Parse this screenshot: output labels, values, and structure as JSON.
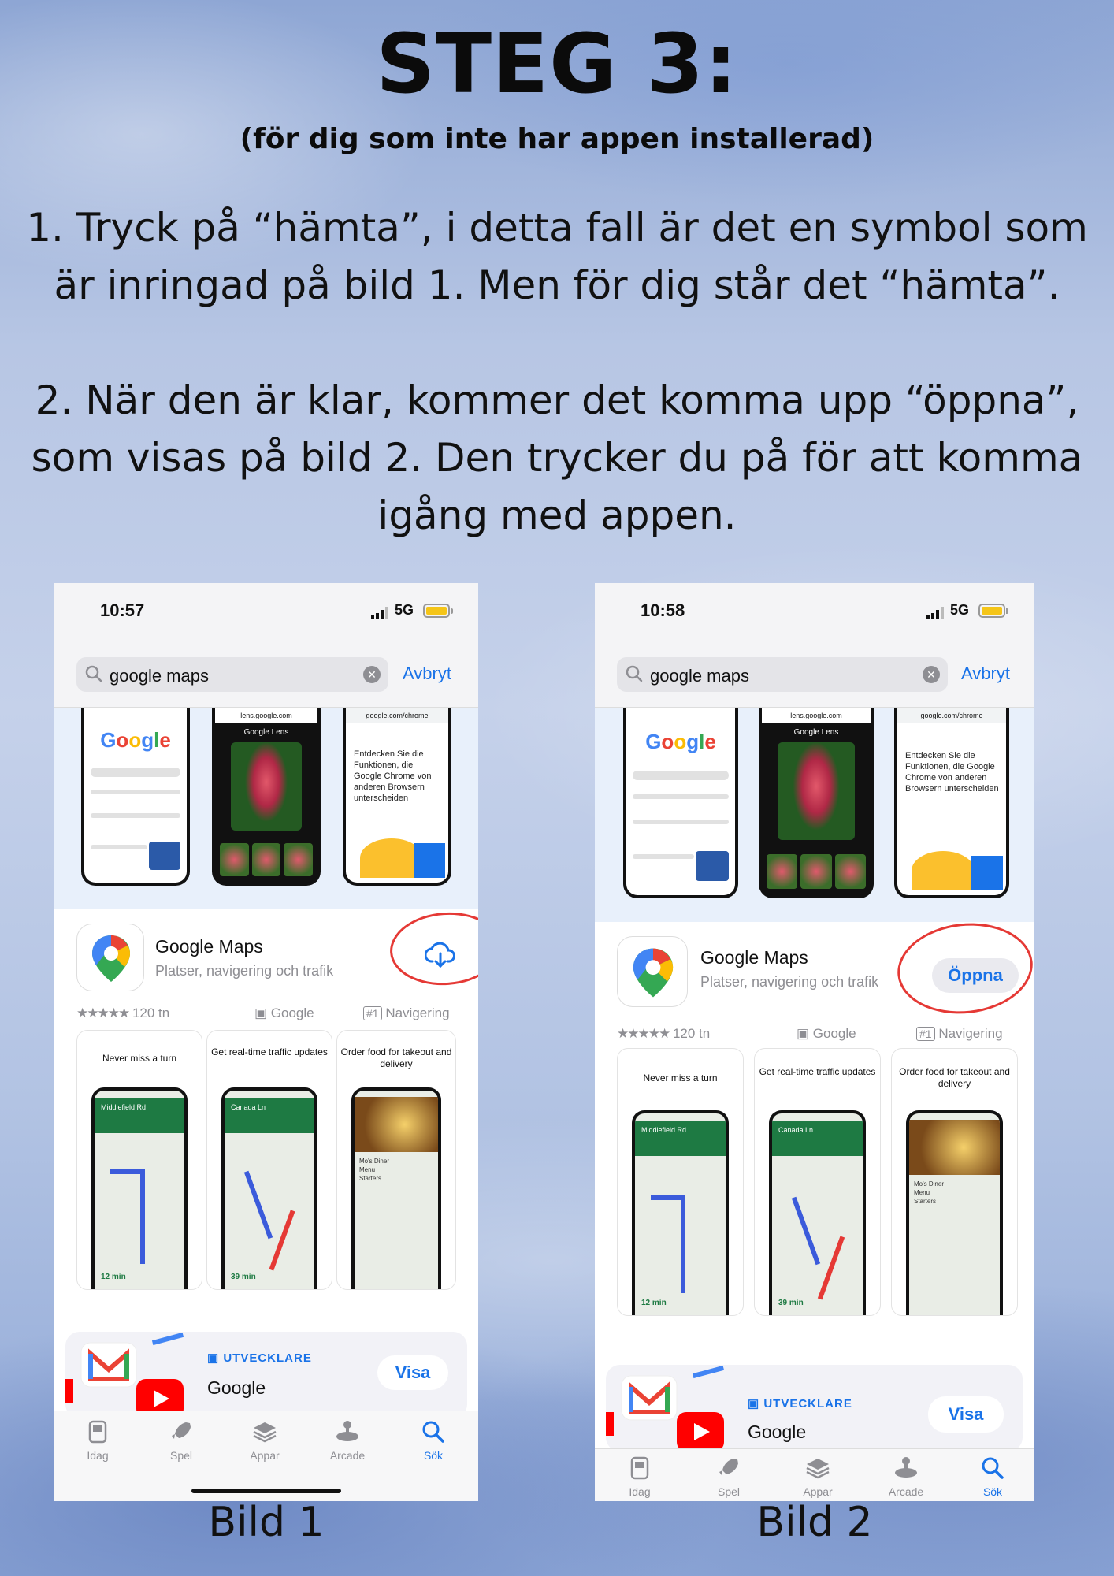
{
  "header": {
    "title": "STEG 3:",
    "subtitle": "(för dig som inte har appen installerad)"
  },
  "instructions": {
    "step1": "1. Tryck på “hämta”, i detta fall är det en symbol som är inringad på bild 1. Men för dig står det “hämta”.",
    "step2": "2. När den är klar, kommer det komma upp “öppna”, som visas på bild 2. Den trycker du på för att komma igång med appen."
  },
  "captions": [
    "Bild 1",
    "Bild 2"
  ],
  "colors": {
    "accent": "#1a73e8",
    "circle": "#e53935",
    "battery": "#f5c518"
  },
  "phones": [
    {
      "time": "10:57",
      "network": "5G",
      "search_query": "google maps",
      "cancel_label": "Avbryt",
      "screenshot_texts": {
        "lens": "Google Lens",
        "chrome_heading": "Entdecken Sie die Funktionen, die Google Chrome von anderen Browsern unterscheiden"
      },
      "app": {
        "name": "Google Maps",
        "subtitle": "Platser, navigering och trafik",
        "rating_count": "120 tn",
        "developer": "Google",
        "rank": "#1",
        "category": "Navigering",
        "action_icon": "download-cloud-icon"
      },
      "promos": [
        "Never miss a turn",
        "Get real-time traffic updates",
        "Order food for takeout and delivery"
      ],
      "developer_card": {
        "label": "UTVECKLARE",
        "name": "Google",
        "button": "Visa"
      },
      "tabs": [
        "Idag",
        "Spel",
        "Appar",
        "Arcade",
        "Sök"
      ],
      "active_tab": "Sök"
    },
    {
      "time": "10:58",
      "network": "5G",
      "search_query": "google maps",
      "cancel_label": "Avbryt",
      "screenshot_texts": {
        "lens": "Google Lens",
        "chrome_heading": "Entdecken Sie die Funktionen, die Google Chrome von anderen Browsern unterscheiden"
      },
      "app": {
        "name": "Google Maps",
        "subtitle": "Platser, navigering och trafik",
        "rating_count": "120 tn",
        "developer": "Google",
        "rank": "#1",
        "category": "Navigering",
        "action_label": "Öppna"
      },
      "promos": [
        "Never miss a turn",
        "Get real-time traffic updates",
        "Order food for takeout and delivery"
      ],
      "developer_card": {
        "label": "UTVECKLARE",
        "name": "Google",
        "button": "Visa"
      },
      "tabs": [
        "Idag",
        "Spel",
        "Appar",
        "Arcade",
        "Sök"
      ],
      "active_tab": "Sök"
    }
  ]
}
